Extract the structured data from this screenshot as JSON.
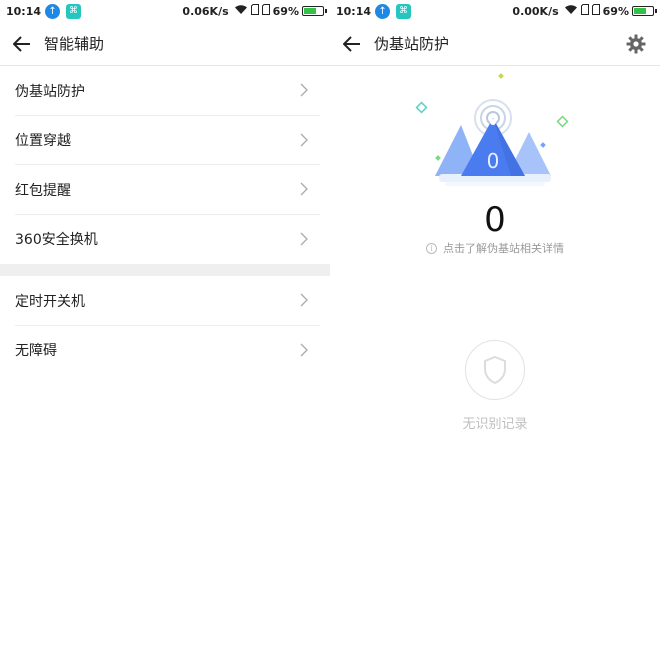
{
  "left": {
    "status": {
      "time": "10:14",
      "speed": "0.06K/s",
      "battery": "69%",
      "battery_level": 0.69
    },
    "title": "智能辅助",
    "items": [
      {
        "label": "伪基站防护"
      },
      {
        "label": "位置穿越"
      },
      {
        "label": "红包提醒"
      },
      {
        "label": "360安全换机"
      }
    ],
    "items2": [
      {
        "label": "定时开关机"
      },
      {
        "label": "无障碍"
      }
    ]
  },
  "right": {
    "status": {
      "time": "10:14",
      "speed": "0.00K/s",
      "battery": "69%",
      "battery_level": 0.69
    },
    "title": "伪基站防护",
    "badge_count": "0",
    "count": "0",
    "hint": "点击了解伪基站相关详情",
    "empty_text": "无识别记录"
  },
  "colors": {
    "accent": "#4a7cf0",
    "bg_gap": "#efefef",
    "green": "#7bd87f"
  },
  "icons": [
    "back-arrow-icon",
    "chevron-right-icon",
    "gear-icon",
    "shield-icon",
    "info-icon",
    "wifi-icon",
    "battery-icon"
  ]
}
